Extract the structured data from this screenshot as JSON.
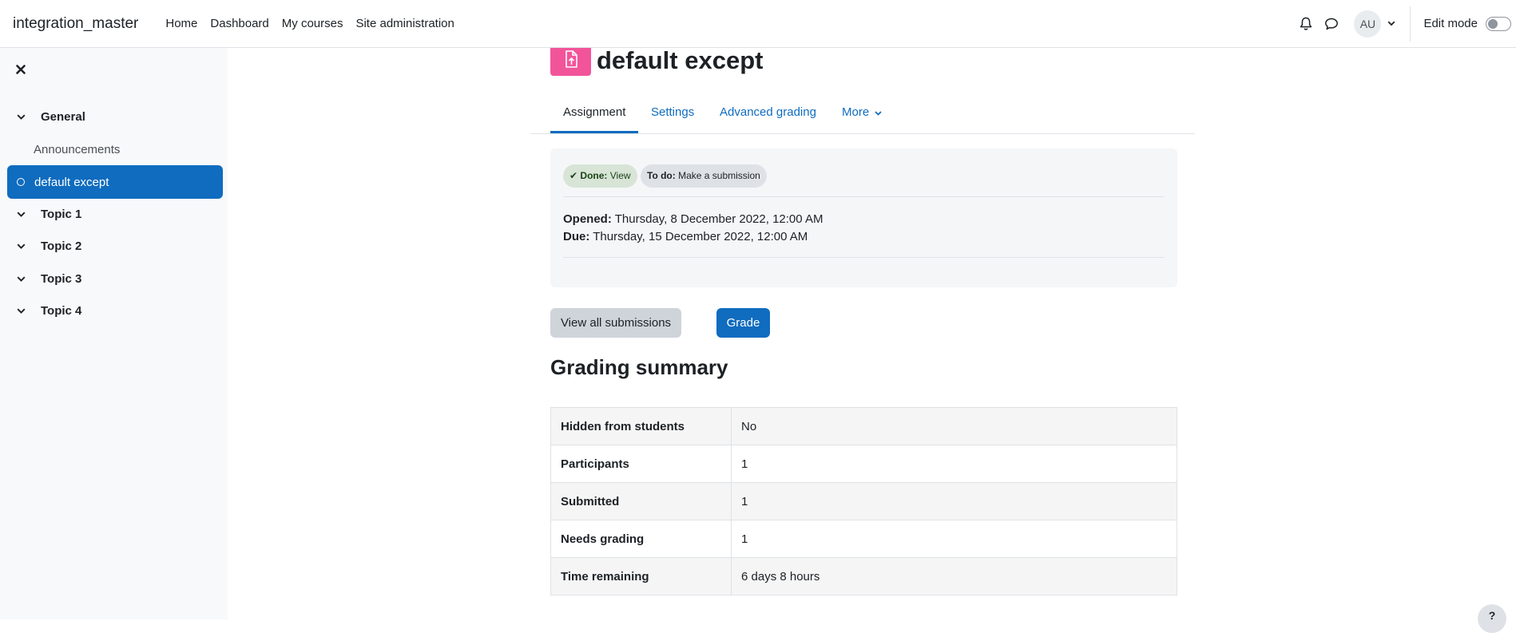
{
  "navbar": {
    "brand": "integration_master",
    "links": [
      "Home",
      "Dashboard",
      "My courses",
      "Site administration"
    ],
    "avatar_initials": "AU",
    "edit_mode_label": "Edit mode"
  },
  "drawer": {
    "items": [
      {
        "label": "General",
        "kind": "section"
      },
      {
        "label": "Announcements",
        "kind": "sub"
      },
      {
        "label": "default except",
        "kind": "active"
      },
      {
        "label": "Topic 1",
        "kind": "section"
      },
      {
        "label": "Topic 2",
        "kind": "section"
      },
      {
        "label": "Topic 3",
        "kind": "section"
      },
      {
        "label": "Topic 4",
        "kind": "section"
      }
    ]
  },
  "page": {
    "title": "default except",
    "tabs": [
      "Assignment",
      "Settings",
      "Advanced grading",
      "More"
    ],
    "completion": {
      "done_label": "Done:",
      "done_value": "View",
      "todo_label": "To do:",
      "todo_value": "Make a submission"
    },
    "dates": {
      "opened_label": "Opened:",
      "opened_value": "Thursday, 8 December 2022, 12:00 AM",
      "due_label": "Due:",
      "due_value": "Thursday, 15 December 2022, 12:00 AM"
    },
    "buttons": {
      "view_all": "View all submissions",
      "grade": "Grade"
    },
    "summary_heading": "Grading summary",
    "summary_rows": [
      {
        "key": "Hidden from students",
        "value": "No"
      },
      {
        "key": "Participants",
        "value": "1"
      },
      {
        "key": "Submitted",
        "value": "1"
      },
      {
        "key": "Needs grading",
        "value": "1"
      },
      {
        "key": "Time remaining",
        "value": "6 days 8 hours"
      }
    ],
    "help_label": "?"
  },
  "colors": {
    "primary": "#0f6cbf",
    "activity_icon": "#f2549a",
    "done_badge": "#d7e4d6"
  }
}
